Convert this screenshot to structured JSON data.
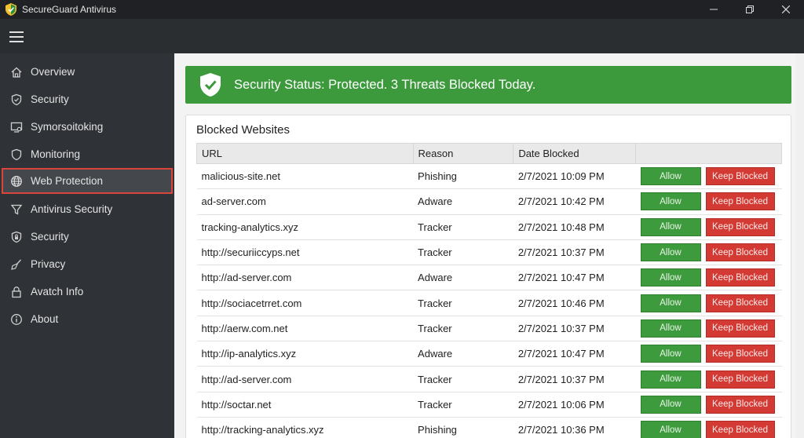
{
  "window": {
    "title": "SecureGuard Antivirus",
    "logo_icon": "shield-logo-icon",
    "controls": [
      "minimize-icon",
      "restore-icon",
      "close-icon"
    ]
  },
  "topbar": {
    "menu_icon": "hamburger-icon"
  },
  "sidebar": {
    "items": [
      {
        "label": "Overview",
        "icon": "home-icon"
      },
      {
        "label": "Security",
        "icon": "shield-check-icon"
      },
      {
        "label": "Symorsoitoking",
        "icon": "monitor-icon"
      },
      {
        "label": "Monitoring",
        "icon": "shield-icon"
      },
      {
        "label": "Web Protection",
        "icon": "globe-icon",
        "active": true
      },
      {
        "label": "Antivirus Security",
        "icon": "filter-icon"
      },
      {
        "label": "Security",
        "icon": "shield-lock-icon"
      },
      {
        "label": "Privacy",
        "icon": "broom-icon"
      },
      {
        "label": "Avatch Info",
        "icon": "lock-icon"
      },
      {
        "label": "About",
        "icon": "info-icon"
      }
    ],
    "active_border_color": "#d9453a"
  },
  "status": {
    "text": "Security Status: Protected. 3 Threats Blocked Today.",
    "icon": "shield-check-icon",
    "color": "#3c9a3d"
  },
  "blocked": {
    "title": "Blocked Websites",
    "columns": [
      "URL",
      "Reason",
      "Date Blocked",
      ""
    ],
    "allow_label": "Allow",
    "keep_label": "Keep Blocked",
    "rows": [
      {
        "url": "malicious-site.net",
        "reason": "Phishing",
        "date": "2/7/2021 10:09 PM"
      },
      {
        "url": "ad-server.com",
        "reason": "Adware",
        "date": "2/7/2021 10:42 PM"
      },
      {
        "url": "tracking-analytics.xyz",
        "reason": "Tracker",
        "date": "2/7/2021 10:48 PM"
      },
      {
        "url": "http://securiiccyps.net",
        "reason": "Tracker",
        "date": "2/7/2021 10:37 PM"
      },
      {
        "url": "http://ad-server.com",
        "reason": "Adware",
        "date": "2/7/2021 10:47 PM"
      },
      {
        "url": "http://sociacetrret.com",
        "reason": "Tracker",
        "date": "2/7/2021 10:46 PM"
      },
      {
        "url": "http://aerw.com.net",
        "reason": "Tracker",
        "date": "2/7/2021 10:37 PM"
      },
      {
        "url": "http://ip-analytics.xyz",
        "reason": "Adware",
        "date": "2/7/2021 10:47 PM"
      },
      {
        "url": "http://ad-server.com",
        "reason": "Tracker",
        "date": "2/7/2021 10:37 PM"
      },
      {
        "url": "http://soctar.net",
        "reason": "Tracker",
        "date": "2/7/2021 10:06 PM"
      },
      {
        "url": "http://tracking-analytics.xyz",
        "reason": "Phishing",
        "date": "2/7/2021 10:36 PM"
      }
    ],
    "allow_color": "#3d9a3d",
    "keep_color": "#d33a33"
  }
}
